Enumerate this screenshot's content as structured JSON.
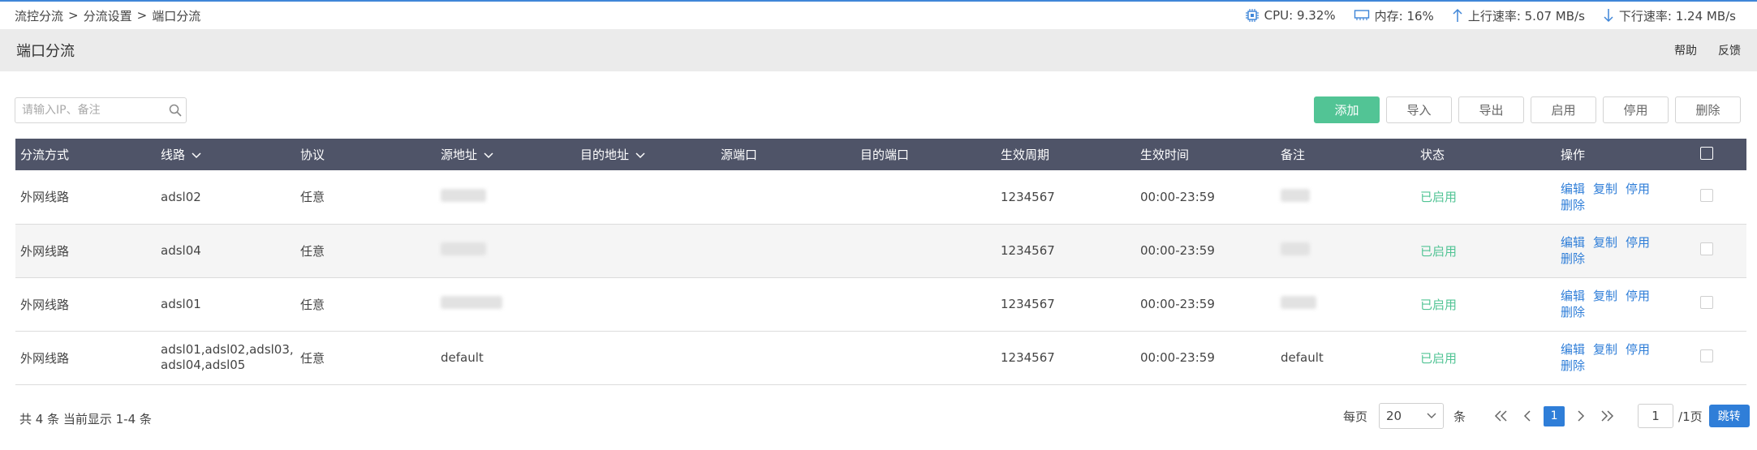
{
  "breadcrumb": [
    "流控分流",
    "分流设置",
    "端口分流"
  ],
  "breadcrumb_separator": ">",
  "stats": {
    "cpu": "CPU: 9.32%",
    "mem": "内存: 16%",
    "up": "上行速率: 5.07 MB/s",
    "down": "下行速率: 1.24 MB/s"
  },
  "header": {
    "title": "端口分流",
    "help": "帮助",
    "feedback": "反馈"
  },
  "search": {
    "placeholder": "请输入IP、备注",
    "value": ""
  },
  "toolbar": {
    "add": "添加",
    "import": "导入",
    "export": "导出",
    "enable": "启用",
    "disable": "停用",
    "delete": "删除"
  },
  "table": {
    "columns": [
      "分流方式",
      "线路",
      "协议",
      "源地址",
      "目的地址",
      "源端口",
      "目的端口",
      "生效周期",
      "生效时间",
      "备注",
      "状态",
      "操作"
    ],
    "rows": [
      {
        "mode": "外网线路",
        "line": "adsl02",
        "protocol": "任意",
        "src": "",
        "dst": "",
        "sport": "",
        "dport": "",
        "period": "1234567",
        "time": "00:00-23:59",
        "note": "",
        "status": "已启用"
      },
      {
        "mode": "外网线路",
        "line": "adsl04",
        "protocol": "任意",
        "src": "",
        "dst": "",
        "sport": "",
        "dport": "",
        "period": "1234567",
        "time": "00:00-23:59",
        "note": "",
        "status": "已启用"
      },
      {
        "mode": "外网线路",
        "line": "adsl01",
        "protocol": "任意",
        "src": "",
        "dst": "",
        "sport": "",
        "dport": "",
        "period": "1234567",
        "time": "00:00-23:59",
        "note": "",
        "status": "已启用"
      },
      {
        "mode": "外网线路",
        "line": "adsl01,adsl02,adsl03,\nadsl04,adsl05",
        "protocol": "任意",
        "src": "default",
        "dst": "",
        "sport": "",
        "dport": "",
        "period": "1234567",
        "time": "00:00-23:59",
        "note": "default",
        "status": "已启用"
      }
    ],
    "row_actions": {
      "edit": "编辑",
      "copy": "复制",
      "disable": "停用",
      "delete": "删除"
    }
  },
  "footer": {
    "summary": "共 4 条 当前显示 1-4 条",
    "per_page_label": "每页",
    "per_page_value": "20",
    "per_page_unit": "条",
    "current_page": "1",
    "goto_value": "1",
    "total_pages": "/1页",
    "jump": "跳转"
  },
  "colors": {
    "accent": "#2f7ed8",
    "success": "#52c495",
    "table_header": "#4f5468"
  }
}
